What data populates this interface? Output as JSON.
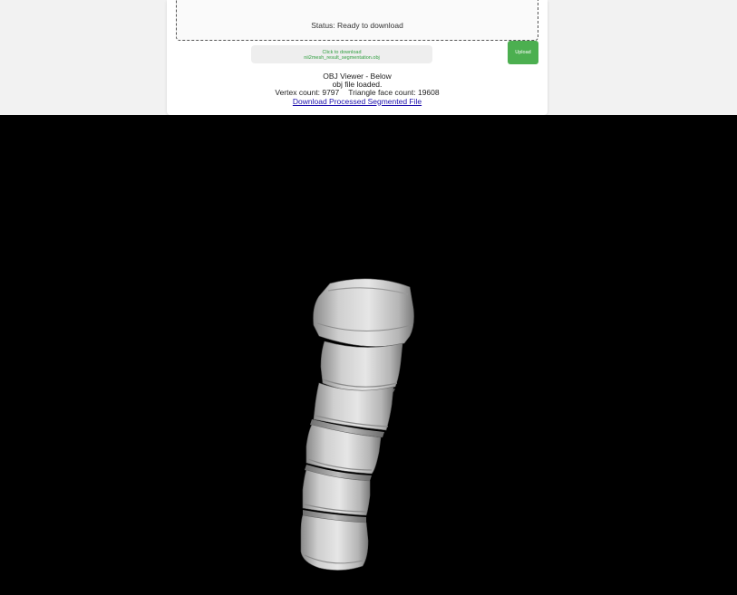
{
  "status": {
    "text": "Status: Ready to download"
  },
  "download_box": {
    "line1": "Click to download",
    "line2": "nii2mesh_result_segmentation.obj"
  },
  "upload_button": {
    "label": "Upload"
  },
  "viewer_info": {
    "title": "OBJ Viewer - Below",
    "loaded": "obj file loaded.",
    "vertex_count": "Vertex count: 9797",
    "triangle_count": "Triangle face count: 19608",
    "download_link": "Download Processed Segmented File"
  },
  "viewer": {
    "background": "#000000",
    "model": "spine-segmentation-mesh"
  },
  "colors": {
    "accent_green": "#4caf50",
    "link_blue": "#1a0dab"
  }
}
